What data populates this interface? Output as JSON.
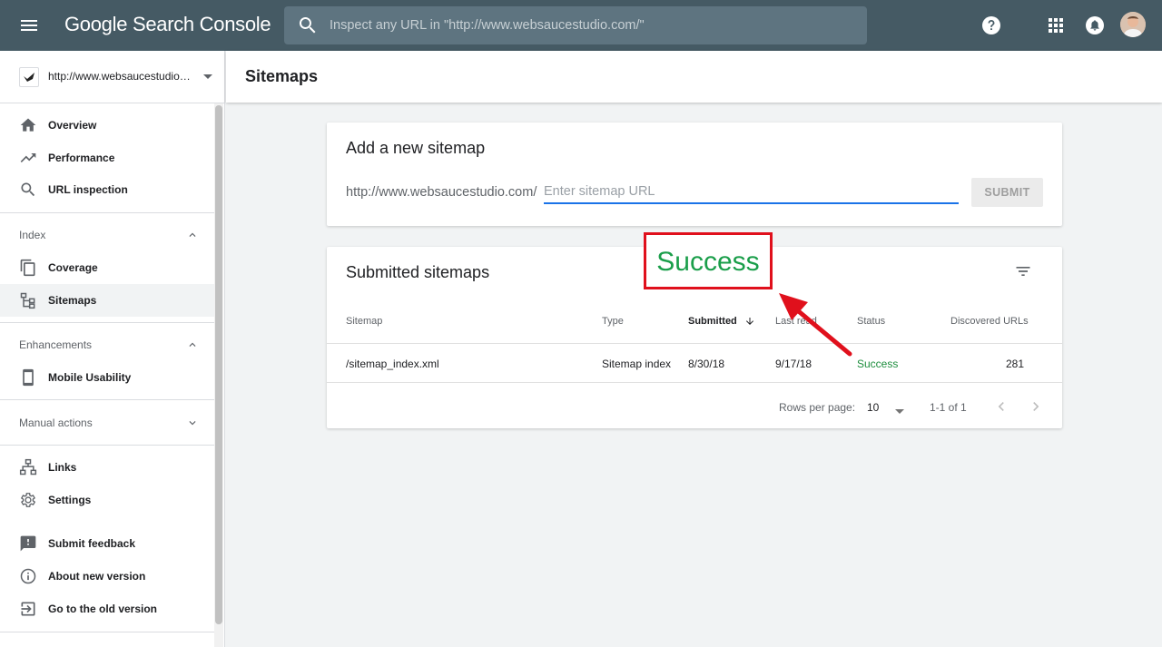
{
  "app": {
    "logo_text": "Google Search Console",
    "search_placeholder": "Inspect any URL in \"http://www.websaucestudio.com/\"",
    "colors": {
      "topbar": "#455a64",
      "accent": "#1a73e8",
      "success": "#1e8e3e",
      "annotation": "#e0101c"
    }
  },
  "sidebar": {
    "property": "http://www.websaucestudio.com/",
    "nav": [
      {
        "label": "Overview",
        "icon": "home-icon"
      },
      {
        "label": "Performance",
        "icon": "trending-up-icon"
      },
      {
        "label": "URL inspection",
        "icon": "search-icon"
      }
    ],
    "index_section": {
      "label": "Index",
      "items": [
        "Coverage",
        "Sitemaps"
      ]
    },
    "enhancements_section": {
      "label": "Enhancements",
      "items": [
        "Mobile Usability"
      ]
    },
    "manual_actions_section": {
      "label": "Manual actions"
    },
    "bottom": [
      "Links",
      "Settings",
      "Submit feedback",
      "About new version",
      "Go to the old version"
    ]
  },
  "page": {
    "title": "Sitemaps"
  },
  "add_sitemap": {
    "title": "Add a new sitemap",
    "prefix": "http://www.websaucestudio.com/",
    "input_placeholder": "Enter sitemap URL",
    "submit_label": "SUBMIT"
  },
  "submitted": {
    "title": "Submitted sitemaps",
    "columns": [
      "Sitemap",
      "Type",
      "Submitted",
      "Last read",
      "Status",
      "Discovered URLs"
    ],
    "rows": [
      {
        "sitemap": "/sitemap_index.xml",
        "type": "Sitemap index",
        "submitted": "8/30/18",
        "last_read": "9/17/18",
        "status": "Success",
        "discovered": "281"
      }
    ],
    "rows_per_page_label": "Rows per page:",
    "rows_per_page_value": "10",
    "range": "1-1 of 1"
  },
  "annotation": {
    "text": "Success"
  }
}
